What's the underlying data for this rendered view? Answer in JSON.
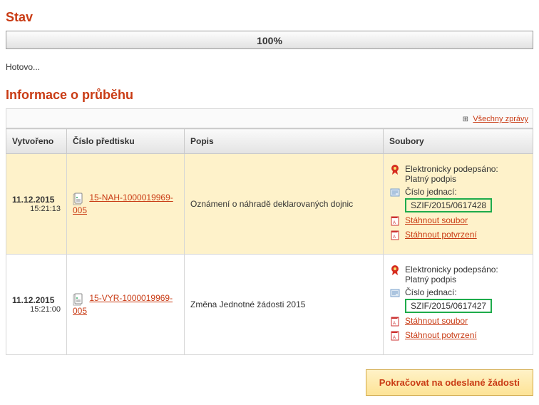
{
  "stav": {
    "heading": "Stav",
    "progress_label": "100%",
    "status_text": "Hotovo..."
  },
  "prubeh": {
    "heading": "Informace o průběhu",
    "all_messages": "Všechny zprávy",
    "columns": {
      "created": "Vytvořeno",
      "number": "Číslo předtisku",
      "desc": "Popis",
      "files": "Soubory"
    },
    "rows": [
      {
        "date": "11.12.2015",
        "time": "15:21:13",
        "num": "15-NAH-1000019969-005",
        "desc": "Oznámení o náhradě deklarovaných dojnic",
        "signed_label": "Elektronicky podepsáno:",
        "signed_status": "Platný podpis",
        "ref_label": "Číslo jednací:",
        "ref_value": "SZIF/2015/0617428",
        "download_file": "Stáhnout soubor",
        "download_confirm": "Stáhnout potvrzení"
      },
      {
        "date": "11.12.2015",
        "time": "15:21:00",
        "num": "15-VYR-1000019969-005",
        "desc": "Změna Jednotné žádosti 2015",
        "signed_label": "Elektronicky podepsáno:",
        "signed_status": "Platný podpis",
        "ref_label": "Číslo jednací:",
        "ref_value": "SZIF/2015/0617427",
        "download_file": "Stáhnout soubor",
        "download_confirm": "Stáhnout potvrzení"
      }
    ]
  },
  "continue_button": "Pokračovat na odeslané žádosti"
}
